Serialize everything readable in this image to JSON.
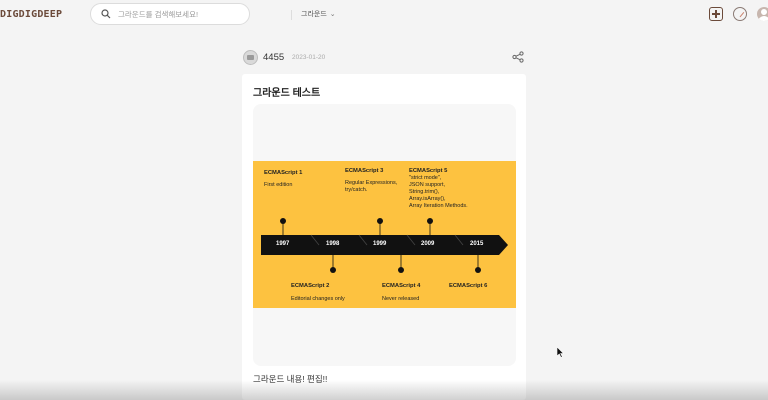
{
  "header": {
    "logo": "DIGDIGDEEP",
    "search": {
      "placeholder": "그라운드를 검색해보세요!",
      "scope": "그라운드"
    },
    "icons": [
      "search-icon",
      "plus-icon",
      "compass-icon",
      "profile-icon"
    ]
  },
  "post": {
    "author": "4455",
    "date": "2023-01-20",
    "title": "그라운드 테스트",
    "body": "그라운드 내용! 편집!!"
  },
  "timeline": {
    "years": [
      "1997",
      "1998",
      "1999",
      "2009",
      "2015"
    ],
    "events": [
      {
        "title": "ECMAScript 1",
        "desc": [
          "First edition"
        ]
      },
      {
        "title": "ECMAScript 2",
        "desc": [
          "Editorial changes only"
        ]
      },
      {
        "title": "ECMAScript 3",
        "desc": [
          "Regular Expressions,",
          "try/catch."
        ]
      },
      {
        "title": "ECMAScript 4",
        "desc": [
          "Never released"
        ]
      },
      {
        "title": "ECMAScript 5",
        "desc": [
          "\"strict mode\",",
          "JSON support,",
          "String.trim(),",
          "Array.isArray(),",
          "Array Iteration Methods."
        ]
      },
      {
        "title": "ECMAScript 6",
        "desc": []
      }
    ],
    "colors": {
      "background": "#fdc240",
      "arrow": "#111111"
    }
  }
}
